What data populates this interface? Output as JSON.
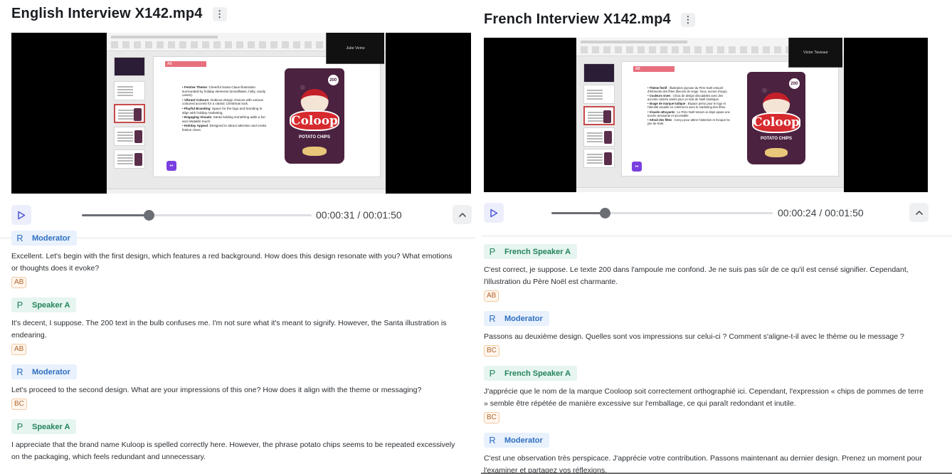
{
  "left": {
    "title": "English Interview X142.mp4",
    "menu_icon": "kebab-icon",
    "video": {
      "participant_name": "Julie Veins",
      "slide_tag": "AB",
      "slide_bullets": [
        {
          "head": "Festive Theme",
          "body": ": Cheerful Santa Claus illustration surrounded by holiday elements (snowflakes, holly, candy canes)."
        },
        {
          "head": "Vibrant Colours",
          "body": ": Dubious design choices with various coloured accents for a classic Christmas look."
        },
        {
          "head": "Playful Branding",
          "body": ": Space for the logo and branding to align with holiday marketing."
        },
        {
          "head": "Engaging Visuals",
          "body": ": Santa holding something adds a fun and relatable touch."
        },
        {
          "head": "Holiday Appeal",
          "body": ": Designed to attract attention and evoke festive cheer."
        }
      ],
      "bag_brand": "Coloop",
      "bag_sub": "POTATO CHIPS",
      "bag_badge": "200"
    },
    "player": {
      "current_time": "00:00:31",
      "duration": "00:01:50",
      "progress": 0.29
    },
    "entries": [
      {
        "speaker": "Moderator",
        "initial": "R",
        "type": "mod",
        "text": "Excellent. Let's begin with the first design, which features a red background. How does this design resonate with you? What emotions or thoughts does it evoke?",
        "tag": "AB"
      },
      {
        "speaker": "Speaker A",
        "initial": "P",
        "type": "sp",
        "text": "It's decent, I suppose. The 200 text in the bulb confuses me. I'm not sure what it's meant to signify. However, the Santa illustration is endearing.",
        "tag": "AB"
      },
      {
        "speaker": "Moderator",
        "initial": "R",
        "type": "mod",
        "text": "Let's proceed to the second design. What are your impressions of this one? How does it align with the theme or messaging?",
        "tag": "BC"
      },
      {
        "speaker": "Speaker A",
        "initial": "P",
        "type": "sp",
        "text": "I appreciate that the brand name Kuloop is spelled correctly here. However, the phrase potato chips seems to be repeated excessively on the packaging, which feels redundant and unnecessary.",
        "tag": ""
      }
    ]
  },
  "right": {
    "title": "French Interview X142.mp4",
    "menu_icon": "kebab-icon",
    "video": {
      "participant_name": "Victor Taveaur",
      "slide_tag": "AB",
      "slide_bullets": [
        {
          "head": "Thème festif",
          "body": " : Illustration joyeuse du Père Noël entouré d'éléments des fêtes (flocons de neige, houx, sucres d'orge)."
        },
        {
          "head": "Couleurs vives",
          "body": " : Choix de design discutables avec des accents colorés variés pour un look de Noël classique."
        },
        {
          "head": "Image de marque ludique",
          "body": " : Espace prévu pour le logo et l'identité visuelle en cohérence avec le marketing des fêtes."
        },
        {
          "head": "Visuels attrayants",
          "body": " : Le Père Noël tenant un objet ajoute une touche amusante et accessible."
        },
        {
          "head": "Attrait des fêtes",
          "body": " : Conçu pour attirer l'attention et évoquer la joie de Noël."
        }
      ],
      "bag_brand": "Coloop",
      "bag_sub": "POTATO CHIPS",
      "bag_badge": "200"
    },
    "player": {
      "current_time": "00:00:24",
      "duration": "00:01:50",
      "progress": 0.24
    },
    "entries": [
      {
        "speaker": "French Speaker A",
        "initial": "P",
        "type": "sp",
        "text": "C'est correct, je suppose. Le texte 200 dans l'ampoule me confond. Je ne suis pas sûr de ce qu'il est censé signifier. Cependant, l'illustration du Père Noël est charmante.",
        "tag": "AB"
      },
      {
        "speaker": "Moderator",
        "initial": "R",
        "type": "mod",
        "text": "Passons au deuxième design. Quelles sont vos impressions sur celui-ci ? Comment s'aligne-t-il avec le thème ou le message ?",
        "tag": "BC"
      },
      {
        "speaker": "French Speaker A",
        "initial": "P",
        "type": "sp",
        "text": "J'apprécie que le nom de la marque Cooloop soit correctement orthographié ici. Cependant, l'expression « chips de pommes de terre » semble être répétée de manière excessive sur l'emballage, ce qui paraît redondant et inutile.",
        "tag": "BC"
      },
      {
        "speaker": "Moderator",
        "initial": "R",
        "type": "mod",
        "text": "C'est une observation très perspicace. J'apprécie votre contribution. Passons maintenant au dernier design. Prenez un moment pour l'examiner et partagez vos réflexions.",
        "tag": ""
      }
    ]
  }
}
